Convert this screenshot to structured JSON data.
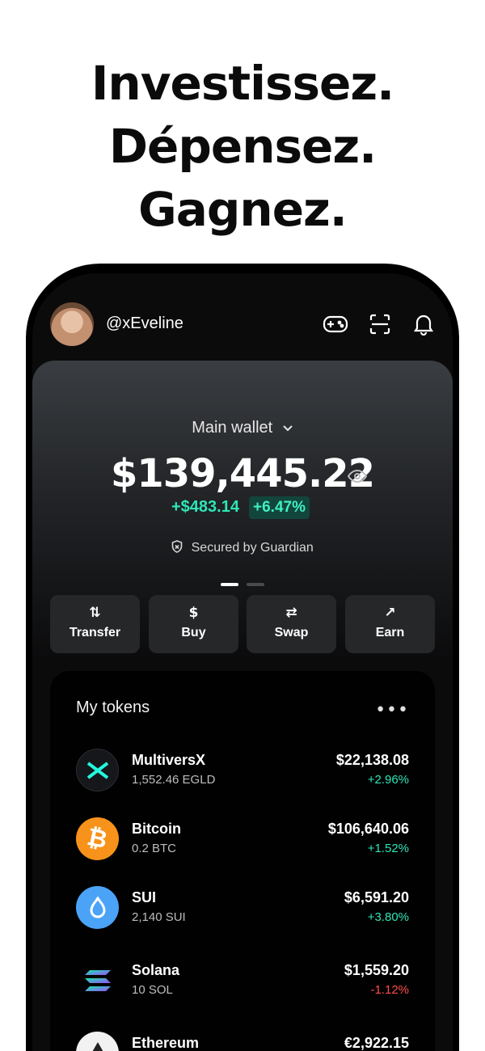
{
  "headline": [
    "Investissez.",
    "Dépensez.",
    "Gagnez."
  ],
  "user": {
    "handle": "@xEveline"
  },
  "icons": {
    "gamepad": "gamepad-icon",
    "scan": "scan-icon",
    "notifications": "bell-icon"
  },
  "wallet": {
    "name": "Main wallet",
    "balance": "$139,445.22",
    "gain": "+$483.14",
    "gain_pct": "+6.47%",
    "secured_text": "Secured by Guardian"
  },
  "actions": [
    {
      "label": "Transfer",
      "icon": "⇅"
    },
    {
      "label": "Buy",
      "icon": "$"
    },
    {
      "label": "Swap",
      "icon": "⇄"
    },
    {
      "label": "Earn",
      "icon": "↗"
    }
  ],
  "tokens_section": {
    "title": "My tokens"
  },
  "tokens": [
    {
      "name": "MultiversX",
      "amount": "1,552.46 EGLD",
      "value": "$22,138.08",
      "change": "+2.96%",
      "positive": true
    },
    {
      "name": "Bitcoin",
      "amount": "0.2 BTC",
      "value": "$106,640.06",
      "change": "+1.52%",
      "positive": true
    },
    {
      "name": "SUI",
      "amount": "2,140 SUI",
      "value": "$6,591.20",
      "change": "+3.80%",
      "positive": true
    },
    {
      "name": "Solana",
      "amount": "10 SOL",
      "value": "$1,559.20",
      "change": "-1.12%",
      "positive": false
    },
    {
      "name": "Ethereum",
      "amount": "",
      "value": "€2,922.15",
      "change": "",
      "positive": true
    }
  ],
  "colors": {
    "positive": "#2ee6b8",
    "negative": "#ff4d4d",
    "accent": "#3ff0c2"
  }
}
